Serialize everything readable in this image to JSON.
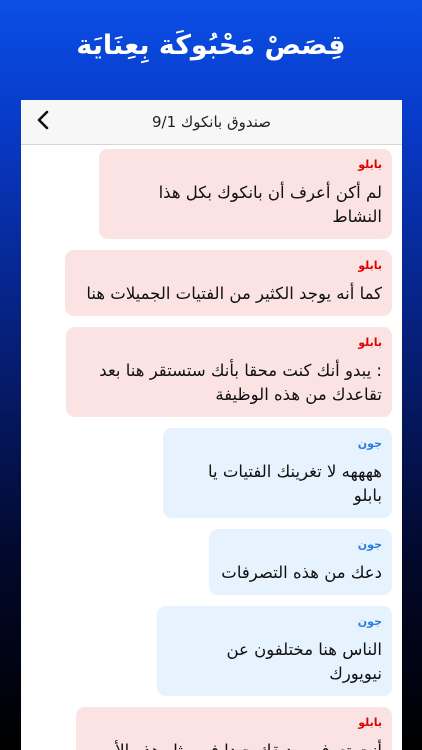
{
  "promo": {
    "title": "قِصَصْ مَحْبُوكَة بِعِنَايَة"
  },
  "header": {
    "title": "صندوق بانكوك 9/1",
    "back_icon": "chevron-left-icon"
  },
  "colors": {
    "background_top": "#0a4fe6",
    "background_bottom": "#000000",
    "bubble_red": "#fbe3e4",
    "bubble_blue": "#e6f2fd",
    "sender_red": "#e00000",
    "sender_blue": "#2a7de1"
  },
  "messages": [
    {
      "sender": "بابلو",
      "text": "لم أكن أعرف أن بانكوك بكل هذا النشاط"
    },
    {
      "sender": "بابلو",
      "text": "كما أنه يوجد الكثير من الفتيات الجميلات هنا"
    },
    {
      "sender": "بابلو",
      "text": ": يبدو أنك كنت محقا بأنك ستستقر هنا بعد تقاعدك من هذه الوظيفة"
    },
    {
      "sender": "جون",
      "text": "ههههه لا تغرينك الفتيات يا بابلو"
    },
    {
      "sender": "جون",
      "text": "دعك من  هذه التصرفات"
    },
    {
      "sender": "جون",
      "text": "الناس هنا مختلفون عن نيويورك"
    },
    {
      "sender": "بابلو",
      "text": "أنت تعرف صديقك جيدا في مثل هذه الأمور"
    }
  ]
}
